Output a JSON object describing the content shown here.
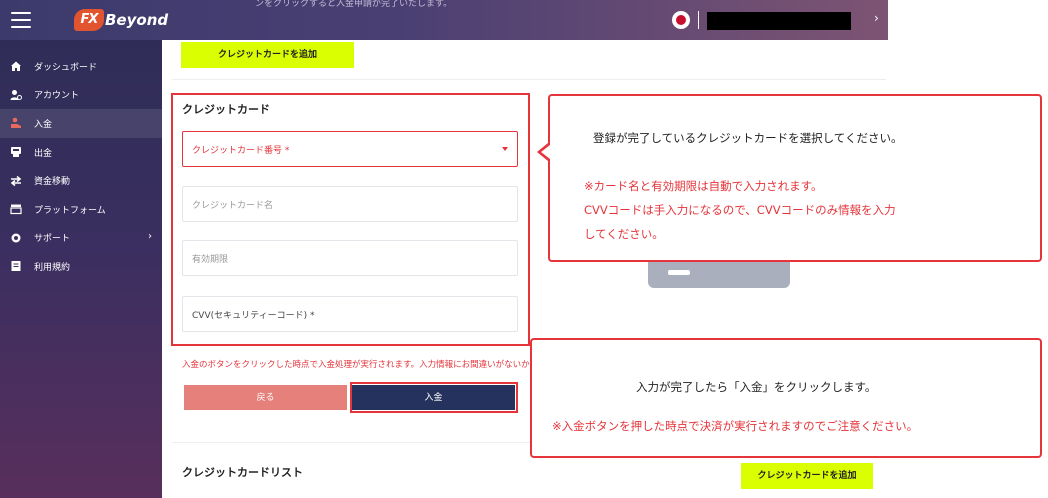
{
  "header": {
    "brand": "Beyond",
    "brand_mark": "FX",
    "notice_text": "ンをクリックすると入金申請が完了いたします。",
    "chevron": "›"
  },
  "sidebar": {
    "items": [
      {
        "label": "ダッシュボード",
        "icon": "home-icon"
      },
      {
        "label": "アカウント",
        "icon": "user-account-icon"
      },
      {
        "label": "入金",
        "icon": "deposit-icon",
        "active": true
      },
      {
        "label": "出金",
        "icon": "withdraw-icon"
      },
      {
        "label": "資金移動",
        "icon": "transfer-arrows-icon"
      },
      {
        "label": "プラットフォーム",
        "icon": "platform-icon"
      },
      {
        "label": "サポート",
        "icon": "support-icon",
        "arrow": "›"
      },
      {
        "label": "利用規約",
        "icon": "terms-icon"
      }
    ]
  },
  "main": {
    "add_card_top_label": "クレジットカードを追加",
    "section_title": "クレジットカード",
    "fields": {
      "card_number": "クレジットカード番号 *",
      "card_name": "クレジットカード名",
      "expiry": "有効期限",
      "cvv": "CVV(セキュリティーコード) *"
    },
    "warning": "入金のボタンをクリックした時点で入金処理が実行されます。入力情報にお間違いがないかご確認ください。",
    "back_label": "戻る",
    "deposit_label": "入金",
    "list_title": "クレジットカードリスト",
    "add_card_bottom_label": "クレジットカードを追加"
  },
  "callouts": {
    "select": {
      "line1": "登録が完了しているクレジットカードを選択してください。",
      "line2": "※カード名と有効期限は自動で入力されます。",
      "line3": "CVVコードは手入力になるので、CVVコードのみ情報を入力",
      "line4": "してください。"
    },
    "deposit": {
      "line1": "入力が完了したら「入金」をクリックします。",
      "line2": "※入金ボタンを押した時点で決済が実行されますのでご注意ください。"
    }
  },
  "colors": {
    "accent_yellow": "#d9ff00",
    "highlight_red": "#e5343a",
    "deposit_navy": "#25325e",
    "back_salmon": "#e6807b"
  }
}
